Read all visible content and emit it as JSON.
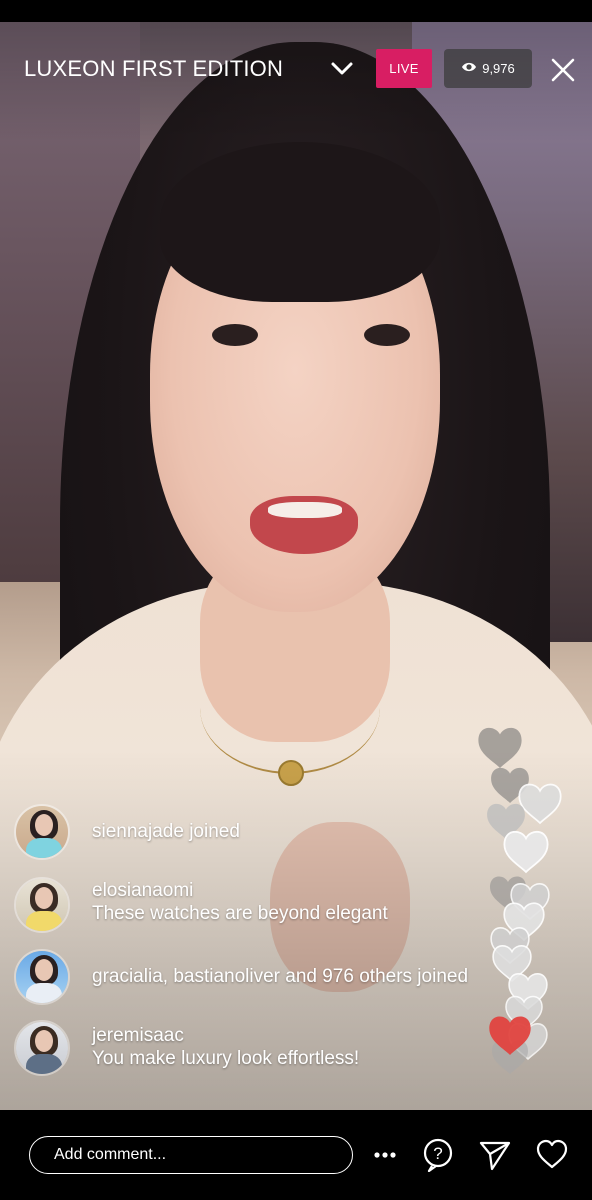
{
  "header": {
    "title": "LUXEON FIRST EDITION",
    "live_label": "LIVE",
    "viewer_count": "9,976"
  },
  "comments": [
    {
      "user": "siennajade joined",
      "message": ""
    },
    {
      "user": "elosianaomi",
      "message": "These watches are beyond elegant"
    },
    {
      "user": "gracialia, bastianoliver and 976 others joined",
      "message": ""
    },
    {
      "user": "jeremisaac",
      "message": "You make luxury look effortless!"
    }
  ],
  "bottom_bar": {
    "comment_placeholder": "Add comment..."
  },
  "icons": {
    "chevron": "chevron-down-icon",
    "close": "close-icon",
    "eye": "eye-icon",
    "more": "more-icon",
    "question": "question-icon",
    "send": "send-icon",
    "heart": "heart-icon"
  },
  "colors": {
    "live_badge": "#d81e63",
    "reaction_heart_red": "#e0433f",
    "reaction_heart_gray": "#d9d9d9"
  }
}
